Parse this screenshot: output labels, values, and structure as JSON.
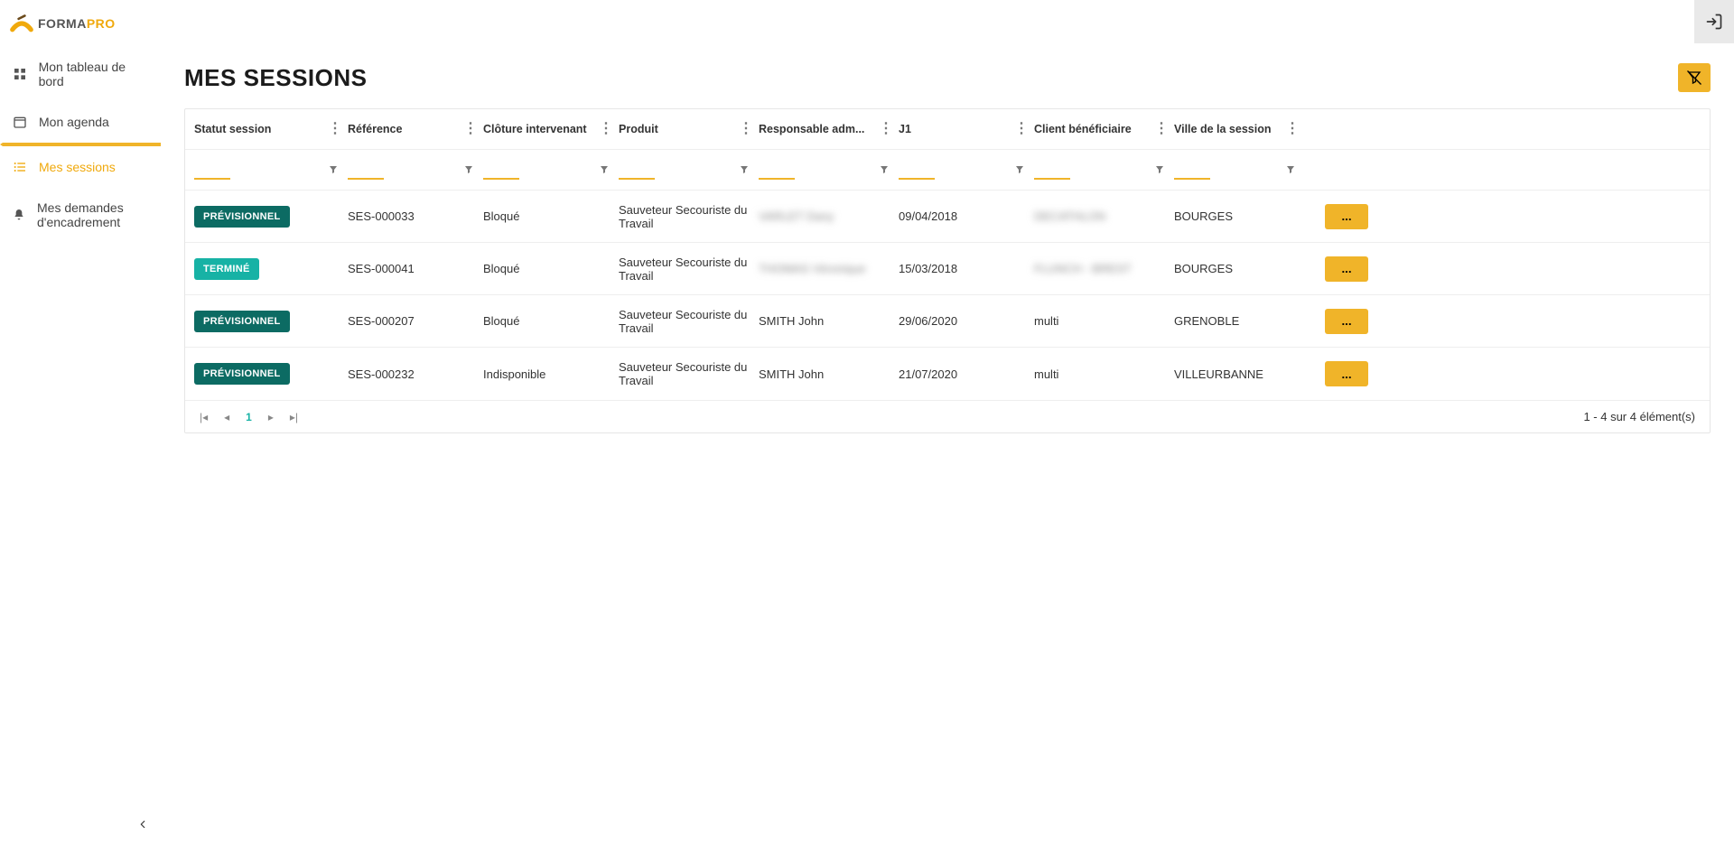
{
  "brand": {
    "part1": "FORMA",
    "part2": "PRO"
  },
  "sidebar": {
    "items": [
      {
        "label": "Mon tableau de bord",
        "icon": "dashboard-icon"
      },
      {
        "label": "Mon agenda",
        "icon": "calendar-icon"
      },
      {
        "label": "Mes sessions",
        "icon": "list-icon"
      },
      {
        "label": "Mes demandes d'encadrement",
        "icon": "bell-icon"
      }
    ],
    "active_index": 2
  },
  "page": {
    "title": "MES SESSIONS"
  },
  "grid": {
    "columns": [
      "Statut session",
      "Référence",
      "Clôture intervenant",
      "Produit",
      "Responsable adm...",
      "J1",
      "Client bénéficiaire",
      "Ville de la session"
    ],
    "rows": [
      {
        "status": "PRÉVISIONNEL",
        "status_kind": "previsionnel",
        "reference": "SES-000033",
        "cloture": "Bloqué",
        "produit": "Sauveteur Secouriste du Travail",
        "responsable": "VARLET Dany",
        "responsable_redacted": true,
        "j1": "09/04/2018",
        "client": "DECATHLON",
        "client_redacted": true,
        "ville": "BOURGES"
      },
      {
        "status": "TERMINÉ",
        "status_kind": "termine",
        "reference": "SES-000041",
        "cloture": "Bloqué",
        "produit": "Sauveteur Secouriste du Travail",
        "responsable": "THOMAS Véronique",
        "responsable_redacted": true,
        "j1": "15/03/2018",
        "client": "FLUNCH - BREST",
        "client_redacted": true,
        "ville": "BOURGES"
      },
      {
        "status": "PRÉVISIONNEL",
        "status_kind": "previsionnel",
        "reference": "SES-000207",
        "cloture": "Bloqué",
        "produit": "Sauveteur Secouriste du Travail",
        "responsable": "SMITH John",
        "responsable_redacted": false,
        "j1": "29/06/2020",
        "client": "multi",
        "client_redacted": false,
        "ville": "GRENOBLE"
      },
      {
        "status": "PRÉVISIONNEL",
        "status_kind": "previsionnel",
        "reference": "SES-000232",
        "cloture": "Indisponible",
        "produit": "Sauveteur Secouriste du Travail",
        "responsable": "SMITH John",
        "responsable_redacted": false,
        "j1": "21/07/2020",
        "client": "multi",
        "client_redacted": false,
        "ville": "VILLEURBANNE"
      }
    ],
    "action_label": "...",
    "footer": {
      "current_page": "1",
      "range_text": "1 - 4 sur 4 élément(s)"
    }
  }
}
